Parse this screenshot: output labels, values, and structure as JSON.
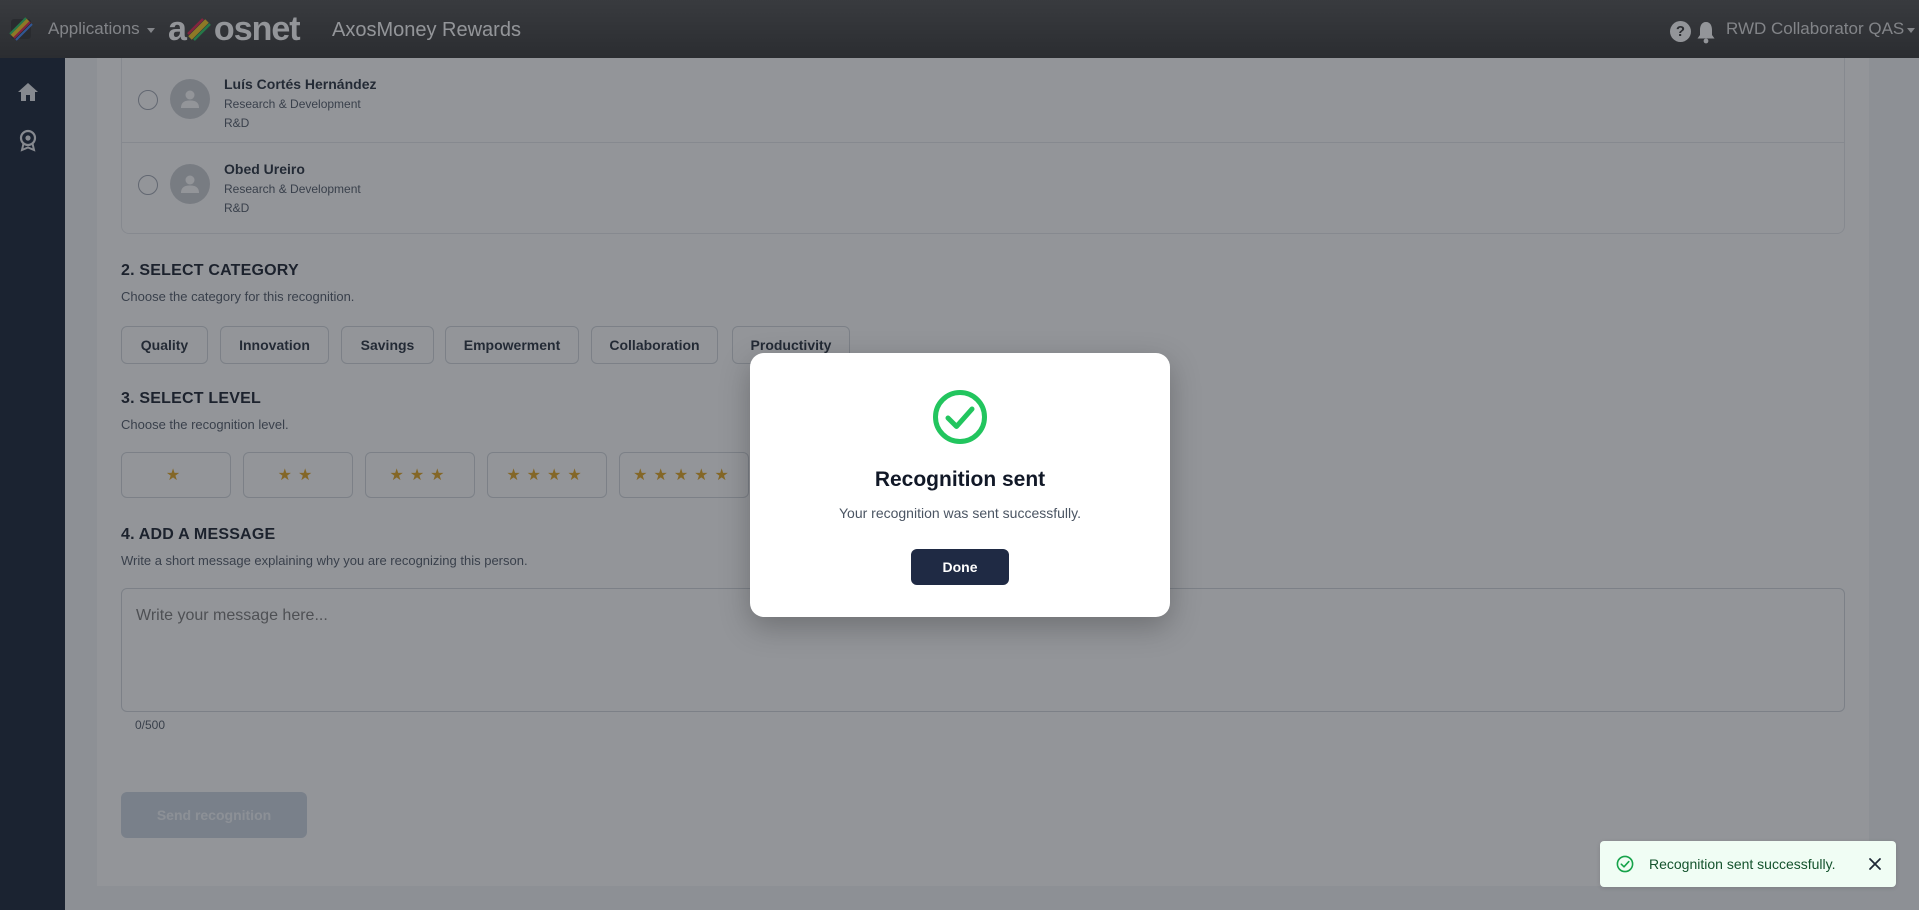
{
  "header": {
    "apps_label": "Applications",
    "brand": {
      "left": "a",
      "right": "osnet"
    },
    "product_title": "AxosMoney Rewards",
    "help_glyph": "?",
    "user_label": "RWD Collaborator QAS"
  },
  "sidebar": {
    "items": [
      {
        "icon": "home-icon"
      },
      {
        "icon": "award-icon"
      }
    ]
  },
  "people": [
    {
      "name": "Luís Cortés Hernández",
      "department": "Research & Development",
      "code": "R&D"
    },
    {
      "name": "Obed Ureiro",
      "department": "Research & Development",
      "code": "R&D"
    }
  ],
  "sections": {
    "category": {
      "title": "2. SELECT CATEGORY",
      "subtitle": "Choose the category for this recognition."
    },
    "level": {
      "title": "3. SELECT LEVEL",
      "subtitle": "Choose the recognition level."
    },
    "message": {
      "title": "4. ADD A MESSAGE",
      "subtitle": "Write a short message explaining why you are recognizing this person."
    }
  },
  "categories": [
    "Quality",
    "Innovation",
    "Savings",
    "Empowerment",
    "Collaboration",
    "Productivity"
  ],
  "levels": [
    "★",
    "★★",
    "★★★",
    "★★★★",
    "★★★★★"
  ],
  "message": {
    "placeholder": "Write your message here...",
    "counter": "0/500"
  },
  "send_button": "Send recognition",
  "modal": {
    "title": "Recognition sent",
    "text": "Your recognition was sent successfully.",
    "done_label": "Done"
  },
  "toast": {
    "text": "Recognition sent successfully."
  },
  "colors": {
    "success": "#22c55e",
    "primary": "#1f2a44",
    "star": "#e0a21a",
    "sidebar": "#0f1a2e"
  }
}
